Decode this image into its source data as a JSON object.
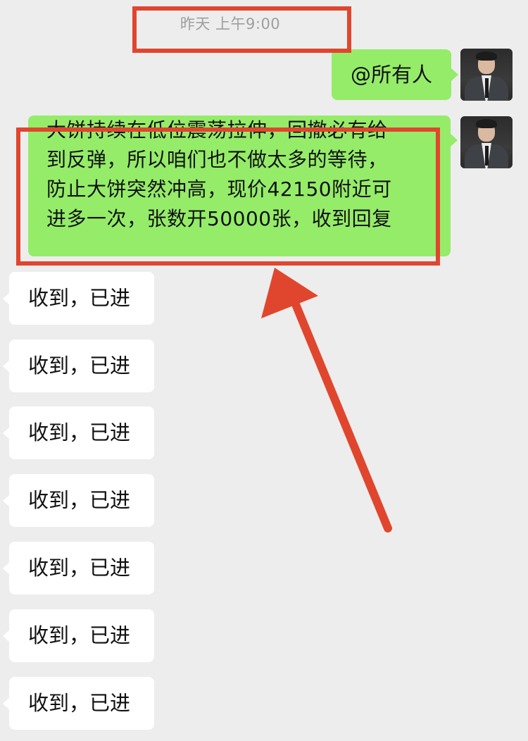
{
  "chat": {
    "timestamp": "昨天 上午9:00",
    "messages": [
      {
        "side": "right",
        "text": "@所有人"
      },
      {
        "side": "right",
        "lines": [
          "大饼持续在低位震荡拉伸，回撤必有给",
          "到反弹，所以咱们也不做太多的等待，",
          "防止大饼突然冲高，现价42150附近可",
          "进多一次，张数开50000张，收到回复"
        ]
      },
      {
        "side": "left",
        "text": "收到，已进"
      },
      {
        "side": "left",
        "text": "收到，已进"
      },
      {
        "side": "left",
        "text": "收到，已进"
      },
      {
        "side": "left",
        "text": "收到，已进"
      },
      {
        "side": "left",
        "text": "收到，已进"
      },
      {
        "side": "left",
        "text": "收到，已进"
      },
      {
        "side": "left",
        "text": "收到，已进"
      }
    ]
  },
  "colors": {
    "background": "#ededed",
    "sent_bubble": "#95ec69",
    "received_bubble": "#ffffff",
    "annotation": "#e0462e"
  },
  "icons": {
    "sender_avatar": "avatar-man-in-suit"
  }
}
